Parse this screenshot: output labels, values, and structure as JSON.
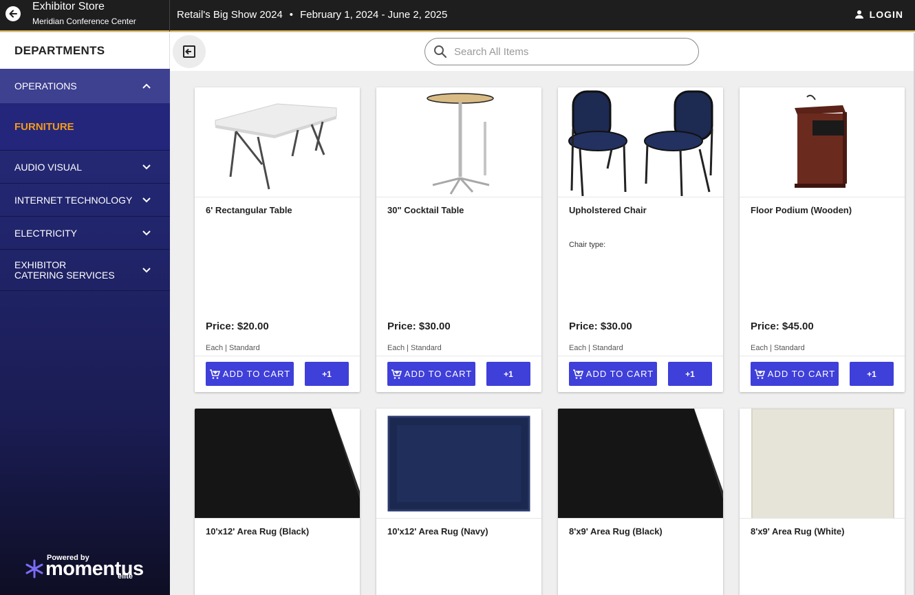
{
  "header": {
    "store_title": "Exhibitor Store",
    "venue": "Meridian Conference Center",
    "event_name": "Retail's Big Show 2024",
    "separator": "•",
    "event_dates": "February 1, 2024 - June 2, 2025",
    "login_label": "LOGIN"
  },
  "sidebar": {
    "heading": "DEPARTMENTS",
    "items": [
      {
        "label": "OPERATIONS",
        "expanded": true
      },
      {
        "label": "FURNITURE",
        "active": true
      },
      {
        "label": "AUDIO VISUAL",
        "expanded": false
      },
      {
        "label": "INTERNET TECHNOLOGY",
        "expanded": false
      },
      {
        "label": "ELECTRICITY",
        "expanded": false
      },
      {
        "label": "EXHIBITOR CATERING SERVICES",
        "expanded": false
      }
    ],
    "powered_by": "Powered by",
    "brand": "momentus",
    "brand_tier": "elite"
  },
  "search": {
    "placeholder": "Search All Items",
    "value": ""
  },
  "products": [
    {
      "name": "6' Rectangular Table",
      "desc": "",
      "price": "Price: $20.00",
      "unit": "Each | Standard",
      "image": "table-image",
      "add_label": "ADD TO CART",
      "plus_label": "+1"
    },
    {
      "name": "30\" Cocktail Table",
      "desc": "",
      "price": "Price: $30.00",
      "unit": "Each | Standard",
      "image": "cocktail-table-image",
      "add_label": "ADD TO CART",
      "plus_label": "+1"
    },
    {
      "name": "Upholstered Chair",
      "desc": "Chair type:",
      "price": "Price: $30.00",
      "unit": "Each | Standard",
      "image": "chairs-image",
      "add_label": "ADD TO CART",
      "plus_label": "+1"
    },
    {
      "name": "Floor Podium (Wooden)",
      "desc": "",
      "price": "Price: $45.00",
      "unit": "Each | Standard",
      "image": "podium-image",
      "add_label": "ADD TO CART",
      "plus_label": "+1"
    },
    {
      "name": "10'x12' Area Rug (Black)",
      "image": "rug-black-image"
    },
    {
      "name": "10'x12' Area Rug (Navy)",
      "image": "rug-navy-image"
    },
    {
      "name": "8'x9' Area Rug (Black)",
      "image": "rug-black-image"
    },
    {
      "name": "8'x9' Area Rug (White)",
      "image": "rug-white-image"
    }
  ],
  "colors": {
    "accent": "#3f3fd9",
    "active_nav": "#f39a1c",
    "topbar": "#1e1e1e",
    "sidebar": "#23267a"
  }
}
